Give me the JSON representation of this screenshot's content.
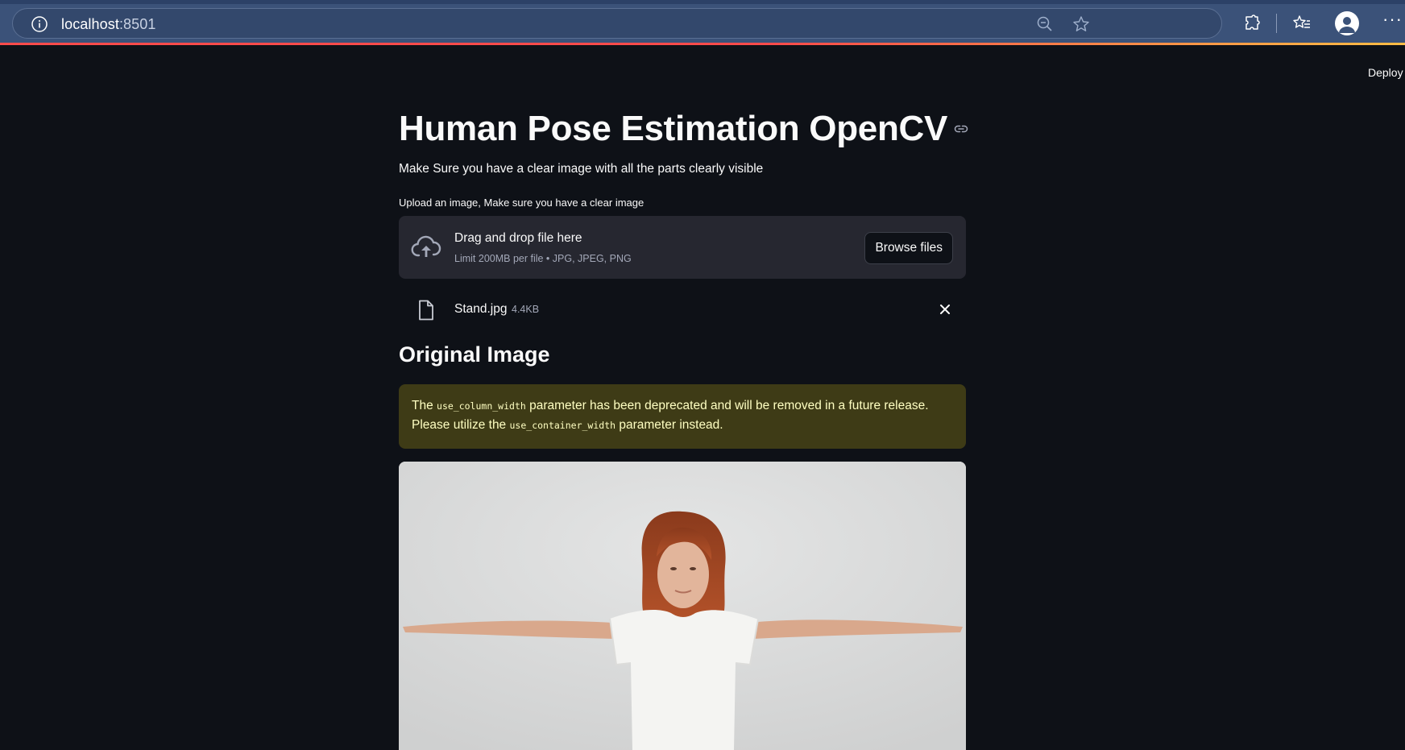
{
  "browser": {
    "url_host": "localhost",
    "url_port": ":8501"
  },
  "app": {
    "deploy_label": "Deploy",
    "title": "Human Pose Estimation OpenCV",
    "subtitle": "Make Sure you have a clear image with all the parts clearly visible",
    "uploader": {
      "label": "Upload an image, Make sure you have a clear image",
      "drop_text": "Drag and drop file here",
      "limit_text": "Limit 200MB per file • JPG, JPEG, PNG",
      "browse_label": "Browse files"
    },
    "uploaded_file": {
      "name": "Stand.jpg",
      "size": "4.4KB"
    },
    "section_title": "Original Image",
    "warning": {
      "part1": "The ",
      "code1": "use_column_width",
      "part2": " parameter has been deprecated and will be removed in a future release. Please utilize the ",
      "code2": "use_container_width",
      "part3": " parameter instead."
    }
  },
  "colors": {
    "background": "#0e1117",
    "dropzone": "#262730",
    "warning_bg": "#3e3b16",
    "warning_text": "#ffffc2",
    "browser_bar": "#3b5279"
  },
  "icons": [
    "info-icon",
    "zoom-out-icon",
    "star-icon",
    "extensions-icon",
    "favorites-icon",
    "profile-icon",
    "more-icon",
    "link-icon",
    "cloud-upload-icon",
    "file-icon",
    "close-icon"
  ]
}
